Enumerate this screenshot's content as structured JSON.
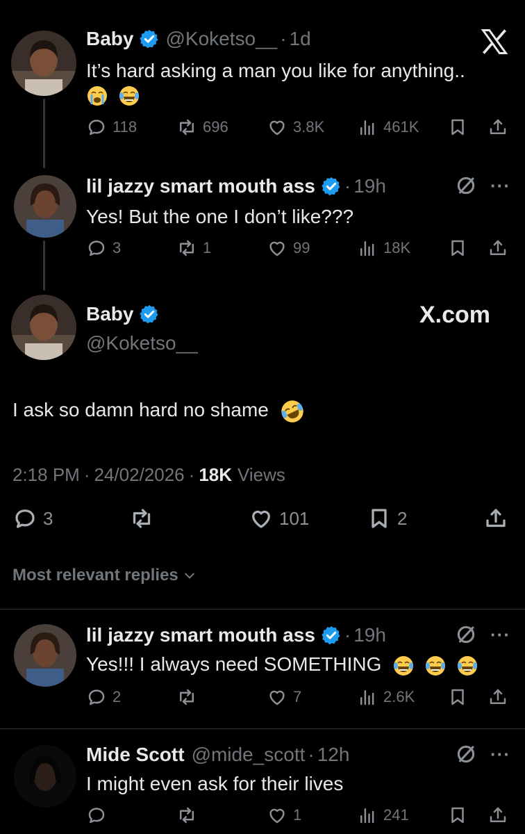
{
  "post1": {
    "name": "Baby",
    "handle": "@Koketso__",
    "time": "1d",
    "text": "It’s hard asking a man you like for anything..",
    "emojis": [
      "loudly-crying-face",
      "tears-of-joy-face"
    ],
    "stats": {
      "replies": "118",
      "reposts": "696",
      "likes": "3.8K",
      "views": "461K"
    },
    "close_icon": "x-logo-icon"
  },
  "reply1": {
    "name": "lil jazzy smart mouth ass",
    "time": "19h",
    "text": "Yes! But the one I don’t like???",
    "stats": {
      "replies": "3",
      "reposts": "1",
      "likes": "99",
      "views": "18K"
    }
  },
  "main": {
    "name": "Baby",
    "handle": "@Koketso__",
    "brand": "X.com",
    "text": "I ask so damn hard no shame",
    "emoji": "rolling-on-floor-laughing-face",
    "time": "2:18 PM",
    "date": "24/02/2026",
    "views_count": "18K",
    "views_label": "Views",
    "stats": {
      "replies": "3",
      "likes": "101",
      "bookmarks": "2"
    }
  },
  "sort": {
    "label": "Most relevant replies"
  },
  "reply2": {
    "name": "lil jazzy smart mouth ass",
    "time": "19h",
    "text": "Yes!!! I always need SOMETHING",
    "emojis": [
      "tears-of-joy-face",
      "tears-of-joy-face",
      "tears-of-joy-face"
    ],
    "stats": {
      "replies": "2",
      "likes": "7",
      "views": "2.6K"
    }
  },
  "reply3": {
    "name": "Mide Scott",
    "handle": "@mide_scott",
    "time": "12h",
    "text": "I might even ask for their lives",
    "stats": {
      "likes": "1",
      "views": "241"
    }
  },
  "separator": "·",
  "colors": {
    "background": "#000000",
    "text": "#e7e9ea",
    "muted": "#71767b",
    "verified": "#1d9bf0",
    "divider": "#2f3336"
  }
}
